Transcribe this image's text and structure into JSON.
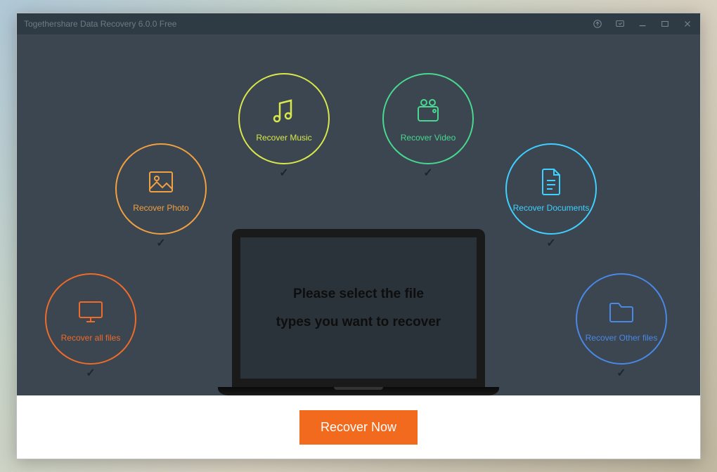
{
  "titlebar": {
    "title": "Togethershare Data Recovery 6.0.0 Free"
  },
  "options": {
    "allfiles": {
      "label": "Recover all files"
    },
    "photo": {
      "label": "Recover Photo"
    },
    "music": {
      "label": "Recover Music"
    },
    "video": {
      "label": "Recover Video"
    },
    "docs": {
      "label": "Recover Documents"
    },
    "other": {
      "label": "Recover Other files"
    }
  },
  "laptop": {
    "line1": "Please select the file",
    "line2": "types you want to recover"
  },
  "footer": {
    "recover_label": "Recover Now"
  }
}
